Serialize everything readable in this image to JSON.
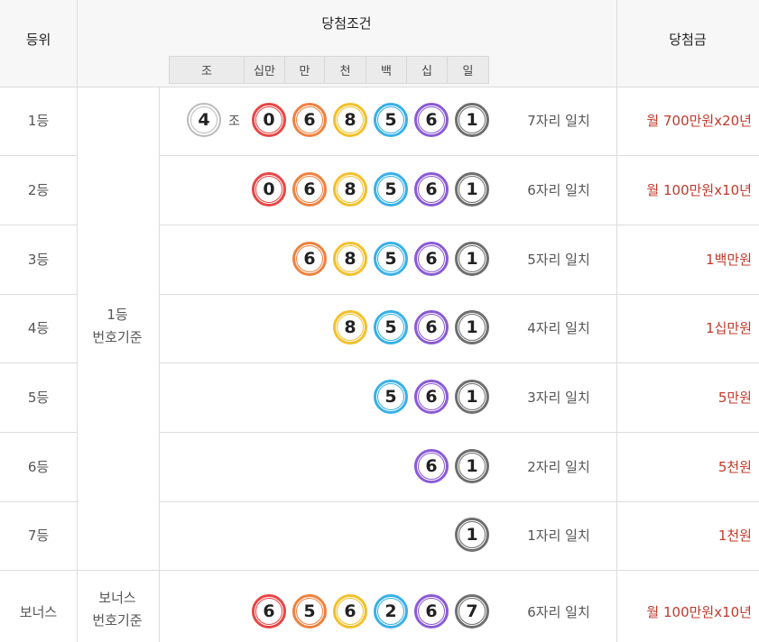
{
  "header": {
    "rank": "등위",
    "condition": "당첨조건",
    "prize": "당첨금",
    "columns": [
      "조",
      "십만",
      "만",
      "천",
      "백",
      "십",
      "일"
    ]
  },
  "basis": {
    "first": [
      "1등",
      "번호기준"
    ],
    "bonus": [
      "보너스",
      "번호기준"
    ]
  },
  "colors": {
    "group": "#bbbbbb",
    "sip_man": "#e84545",
    "man": "#f0813e",
    "cheon": "#f3c02a",
    "baek": "#37b0e8",
    "sip": "#8a5ad6",
    "il": "#6e6e6e",
    "prize_text": "#c0392b"
  },
  "rows": [
    {
      "rank": "1등",
      "group": "4",
      "group_label": "조",
      "digits": [
        "0",
        "6",
        "8",
        "5",
        "6",
        "1"
      ],
      "match": "7자리 일치",
      "prize": "월 700만원x20년"
    },
    {
      "rank": "2등",
      "digits": [
        "0",
        "6",
        "8",
        "5",
        "6",
        "1"
      ],
      "match": "6자리 일치",
      "prize": "월 100만원x10년"
    },
    {
      "rank": "3등",
      "digits": [
        "6",
        "8",
        "5",
        "6",
        "1"
      ],
      "match": "5자리 일치",
      "prize": "1백만원"
    },
    {
      "rank": "4등",
      "digits": [
        "8",
        "5",
        "6",
        "1"
      ],
      "match": "4자리 일치",
      "prize": "1십만원"
    },
    {
      "rank": "5등",
      "digits": [
        "5",
        "6",
        "1"
      ],
      "match": "3자리 일치",
      "prize": "5만원"
    },
    {
      "rank": "6등",
      "digits": [
        "6",
        "1"
      ],
      "match": "2자리 일치",
      "prize": "5천원"
    },
    {
      "rank": "7등",
      "digits": [
        "1"
      ],
      "match": "1자리 일치",
      "prize": "1천원"
    },
    {
      "rank": "보너스",
      "digits": [
        "6",
        "5",
        "6",
        "2",
        "6",
        "7"
      ],
      "match": "6자리 일치",
      "prize": "월 100만원x10년"
    }
  ]
}
